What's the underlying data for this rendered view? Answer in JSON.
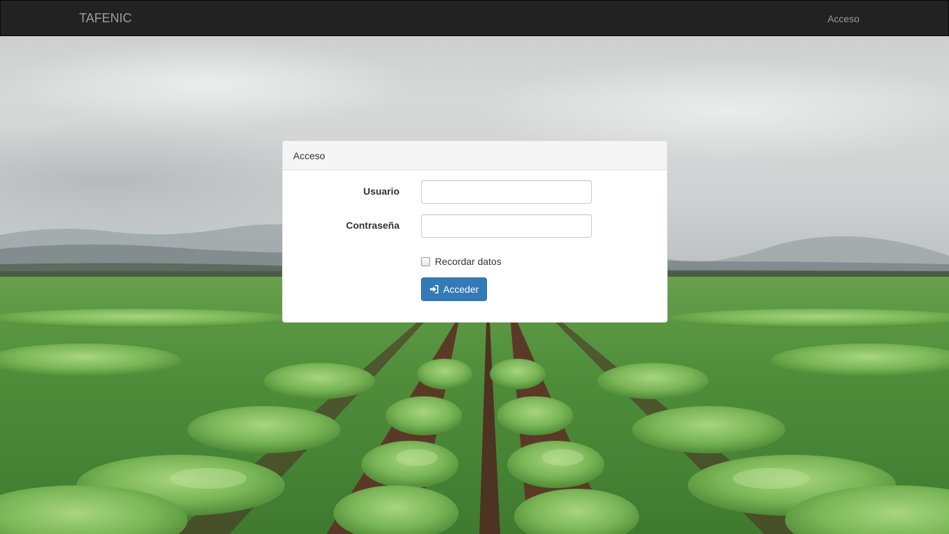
{
  "navbar": {
    "brand": "TAFENIC",
    "link": "Acceso"
  },
  "panel": {
    "heading": "Acceso",
    "fields": [
      {
        "label": "Usuario",
        "value": "",
        "placeholder": ""
      },
      {
        "label": "Contraseña",
        "value": "",
        "placeholder": ""
      }
    ],
    "remember_label": "Recordar datos",
    "remember_checked": false,
    "submit_label": "Acceder",
    "submit_icon": "sign-in-icon"
  },
  "colors": {
    "navbar_bg": "#222222",
    "navbar_text": "#9d9d9d",
    "primary": "#337ab7"
  },
  "background": {
    "scene": "tobacco-field-photo"
  }
}
